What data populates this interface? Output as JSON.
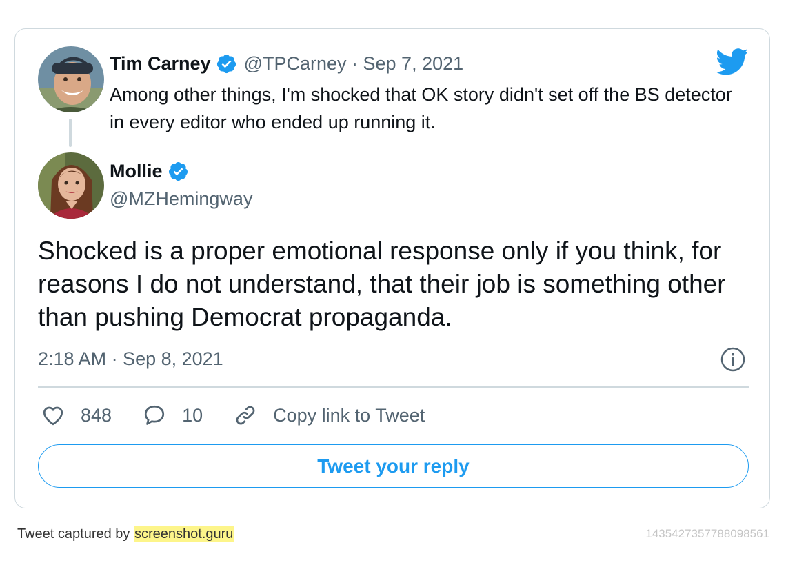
{
  "quoted_tweet": {
    "author_name": "Tim Carney",
    "handle_date": "@TPCarney · Sep 7, 2021",
    "text": "Among other things, I'm shocked that OK story didn't set off the BS detector in every editor who ended up running it."
  },
  "main_tweet": {
    "author_name": "Mollie",
    "handle": "@MZHemingway",
    "text": "Shocked is a proper emotional response only if you think, for reasons I do not understand, that their job is something other than pushing Democrat propaganda.",
    "timestamp": "2:18 AM · Sep 8, 2021"
  },
  "actions": {
    "likes": "848",
    "replies": "10",
    "copy_link": "Copy link to Tweet"
  },
  "reply_button": "Tweet your reply",
  "footer": {
    "captured_by": "Tweet captured by",
    "site": "screenshot.guru",
    "tweet_id": "1435427357788098561"
  },
  "colors": {
    "accent": "#1d9bf0",
    "border": "#cfd9de",
    "secondary_text": "#536471",
    "highlight": "#fdf58a"
  },
  "icons": [
    "twitter-bird-icon",
    "verified-badge-icon",
    "info-icon",
    "heart-icon",
    "reply-bubble-icon",
    "link-icon"
  ]
}
